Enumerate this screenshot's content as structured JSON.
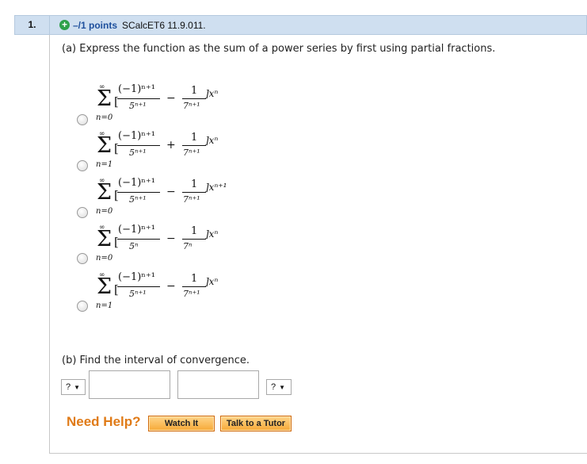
{
  "question": {
    "number": "1.",
    "points": "–/1 points",
    "source": "SCalcET6 11.9.011."
  },
  "part_a": {
    "prompt": "(a) Express the function as the sum of a power series by first using partial fractions.",
    "choices": [
      {
        "upper": "∞",
        "lower": "n=0",
        "num1": "(−1)ⁿ⁺¹",
        "den1": "5ⁿ⁺¹",
        "op": "−",
        "num2": "1",
        "den2": "7ⁿ⁺¹",
        "tail": "]xⁿ"
      },
      {
        "upper": "∞",
        "lower": "n=1",
        "num1": "(−1)ⁿ⁺¹",
        "den1": "5ⁿ⁺¹",
        "op": "+",
        "num2": "1",
        "den2": "7ⁿ⁺¹",
        "tail": "]xⁿ"
      },
      {
        "upper": "∞",
        "lower": "n=0",
        "num1": "(−1)ⁿ⁺¹",
        "den1": "5ⁿ⁺¹",
        "op": "−",
        "num2": "1",
        "den2": "7ⁿ⁺¹",
        "tail": "]xⁿ⁺¹"
      },
      {
        "upper": "∞",
        "lower": "n=0",
        "num1": "(−1)ⁿ⁺¹",
        "den1": "5ⁿ",
        "op": "−",
        "num2": "1",
        "den2": "7ⁿ",
        "tail": "]xⁿ"
      },
      {
        "upper": "∞",
        "lower": "n=1",
        "num1": "(−1)ⁿ⁺¹",
        "den1": "5ⁿ⁺¹",
        "op": "−",
        "num2": "1",
        "den2": "7ⁿ⁺¹",
        "tail": "]xⁿ"
      }
    ]
  },
  "part_b": {
    "prompt": "(b) Find the interval of convergence.",
    "left_select": "?",
    "right_select": "?",
    "left_value": "",
    "right_value": ""
  },
  "help": {
    "label": "Need Help?",
    "watch": "Watch It",
    "tutor": "Talk to a Tutor"
  },
  "colors": {
    "header_bg": "#cfdff0",
    "points": "#1d4f9c",
    "plus": "#2fa14a",
    "need_help": "#e07b18",
    "button": "#f6a936"
  }
}
